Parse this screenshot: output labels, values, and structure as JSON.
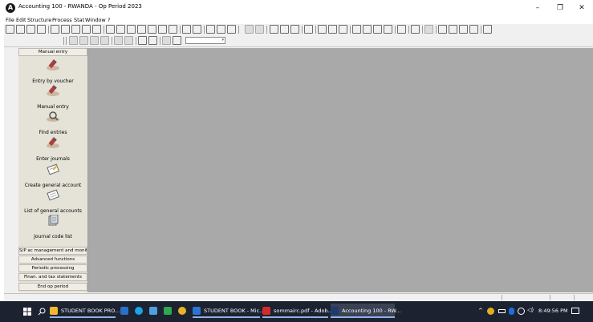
{
  "window": {
    "title": "Accounting 100 - RWANDA - Op Period 2023",
    "controls": {
      "minimize": "–",
      "maximize": "❐",
      "close": "✕"
    }
  },
  "menu": [
    "File",
    "Edit",
    "Structure",
    "Process",
    "Stat",
    "Window",
    "?"
  ],
  "sidebar": {
    "top_header": "Manual entry",
    "items": [
      {
        "label": "Entry by voucher",
        "icon": "pen-entry-icon"
      },
      {
        "label": "Manual entry",
        "icon": "pen-entry-icon"
      },
      {
        "label": "Find entries",
        "icon": "magnifier-icon"
      },
      {
        "label": "Enter journals",
        "icon": "pen-entry-icon"
      },
      {
        "label": "Create general account",
        "icon": "account-card-icon"
      },
      {
        "label": "List of general accounts",
        "icon": "account-card-icon"
      },
      {
        "label": "Journal code list",
        "icon": "journal-icon"
      }
    ],
    "bottom_headers": [
      "S/P ac management and monit",
      "Advanced functions",
      "Periodic processing",
      "Finan. and tax statements",
      "End op period"
    ]
  },
  "taskbar": {
    "apps": [
      {
        "label": "STUDENT BOOK PRO...",
        "color": "#f3b731"
      },
      {
        "label": "STUDENT BOOK - Mic...",
        "color": "#2b74d6"
      },
      {
        "label": "sommairc.pdf - Adob...",
        "color": "#d62a2a"
      },
      {
        "label": "Accounting 100 - RW...",
        "color": "#1e3a6e"
      }
    ],
    "clock": "8:49:56 PM"
  },
  "colors": {
    "workspace": "#a9a9a9",
    "sidebar": "#e5e2d8",
    "taskbar": "#1c2230"
  }
}
